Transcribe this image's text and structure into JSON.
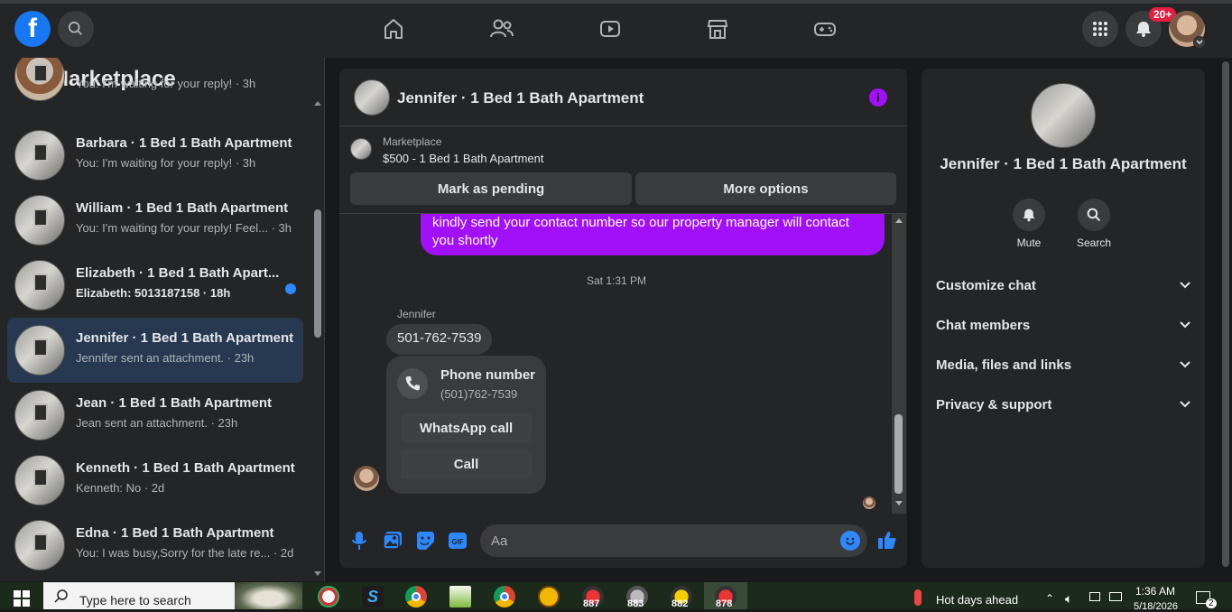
{
  "nav": {
    "fb_logo": "f",
    "icons": [
      "home-icon",
      "friends-icon",
      "watch-icon",
      "marketplace-icon",
      "gaming-icon"
    ],
    "notification_badge": "20+"
  },
  "sidebar": {
    "title": "Marketplace",
    "conversations": [
      {
        "name": "",
        "preview": "You: I'm waiting for your reply! · 3h",
        "unread": false,
        "active": false
      },
      {
        "name": "Barbara · 1 Bed 1 Bath Apartment",
        "preview": "You: I'm waiting for your reply! · 3h",
        "unread": false,
        "active": false
      },
      {
        "name": "William · 1 Bed 1 Bath Apartment",
        "preview": "You: I'm waiting for your reply! Feel... · 3h",
        "unread": false,
        "active": false
      },
      {
        "name": "Elizabeth · 1 Bed 1 Bath Apart...",
        "preview": "Elizabeth: 5013187158 · 18h",
        "unread": true,
        "active": false
      },
      {
        "name": "Jennifer · 1 Bed 1 Bath Apartment",
        "preview": "Jennifer sent an attachment. · 23h",
        "unread": false,
        "active": true
      },
      {
        "name": "Jean · 1 Bed 1 Bath Apartment",
        "preview": "Jean sent an attachment. · 23h",
        "unread": false,
        "active": false
      },
      {
        "name": "Kenneth · 1 Bed 1 Bath Apartment",
        "preview": "Kenneth: No · 2d",
        "unread": false,
        "active": false
      },
      {
        "name": "Edna · 1 Bed 1 Bath Apartment",
        "preview": "You: I was busy,Sorry for the late re... · 2d",
        "unread": false,
        "active": false
      }
    ]
  },
  "chat": {
    "title": "Jennifer · 1 Bed 1 Bath Apartment",
    "listing_source": "Marketplace",
    "listing_title": "$500 - 1 Bed 1 Bath Apartment",
    "mark_pending": "Mark as pending",
    "more_options": "More options",
    "outgoing_message": "kindly send your contact number so our property manager will contact you shortly",
    "timestamp": "Sat 1:31 PM",
    "sender_name": "Jennifer",
    "incoming_message": "501-762-7539",
    "card_title": "Phone number",
    "card_number": "(501)762-7539",
    "whatsapp_call": "WhatsApp call",
    "call": "Call",
    "composer_placeholder": "Aa"
  },
  "info": {
    "title": "Jennifer · 1 Bed 1 Bath Apartment",
    "mute": "Mute",
    "search": "Search",
    "sections": [
      "Customize chat",
      "Chat members",
      "Media, files and links",
      "Privacy & support"
    ]
  },
  "taskbar": {
    "search_placeholder": "Type here to search",
    "weather": "Hot days ahead",
    "time": "1:36 AM",
    "date": "5/18/2026",
    "app_numbers": [
      "887",
      "883",
      "882",
      "878"
    ],
    "notification_count": "2"
  },
  "colors": {
    "accent": "#a20ff9",
    "brand": "#1877f2",
    "unread_dot": "#2d88ff"
  }
}
